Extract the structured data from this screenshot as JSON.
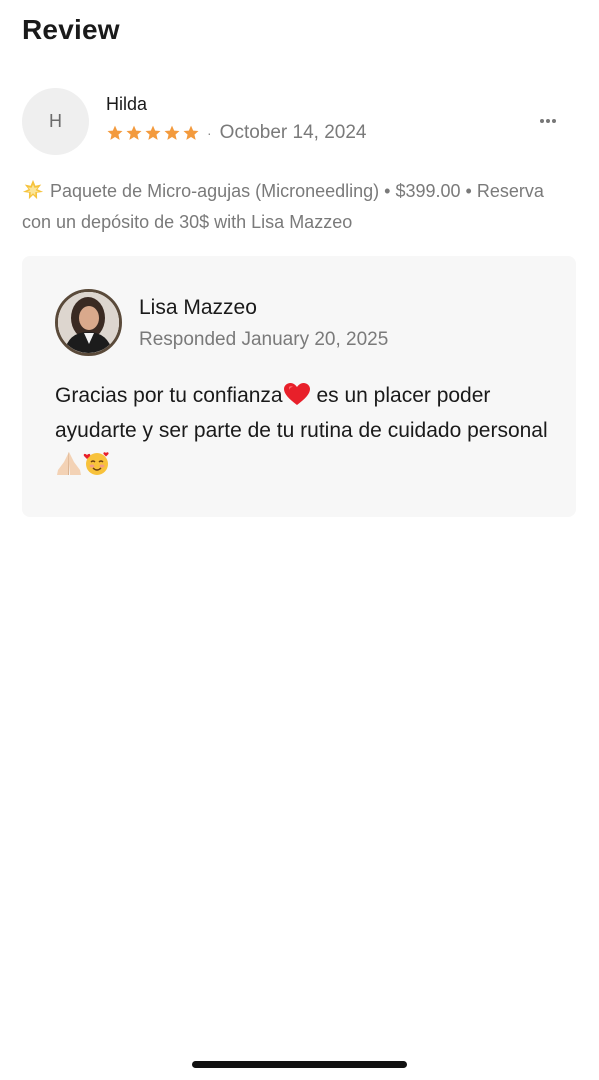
{
  "page": {
    "title": "Review"
  },
  "review": {
    "avatar_initial": "H",
    "reviewer_name": "Hilda",
    "rating": 5,
    "rating_max": 5,
    "date": "October 14, 2024",
    "service_text": "Paquete de Micro-agujas (Microneedling) • $399.00 • Reserva con un depósito de 30$ with Lisa Mazzeo",
    "service_icon": "sparkle-star-icon"
  },
  "response": {
    "responder_name": "Lisa Mazzeo",
    "responded_label": "Responded January 20, 2025",
    "text_part1": "Gracias por tu confianza",
    "text_part2": " es un placer poder ayudarte y ser parte de tu rutina de cuidado personal"
  },
  "colors": {
    "star": "#f39a3d",
    "card_background": "#f7f7f7",
    "muted_text": "#7a7a7a"
  }
}
